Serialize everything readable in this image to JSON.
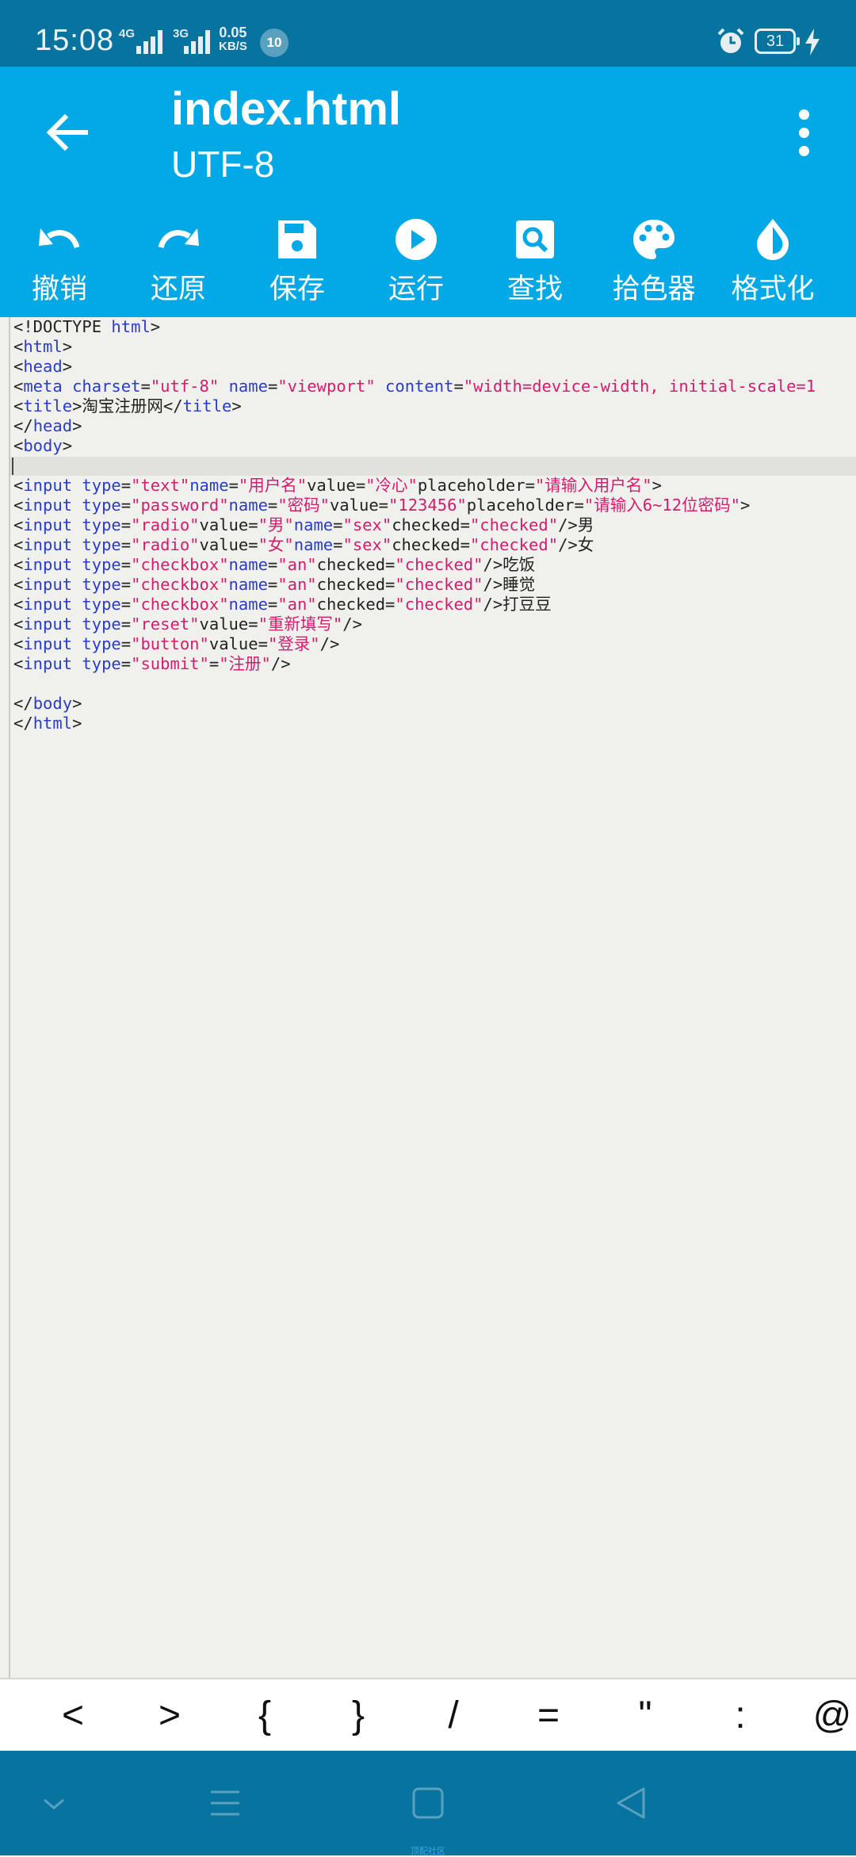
{
  "status_bar": {
    "time": "15:08",
    "network": "4G",
    "network2": "3G",
    "speed_value": "0.05",
    "speed_unit": "KB/S",
    "notification_count": "10",
    "battery": "31"
  },
  "header": {
    "title": "index.html",
    "subtitle": "UTF-8"
  },
  "toolbar": {
    "items": [
      {
        "label": "撤销",
        "icon": "undo-icon"
      },
      {
        "label": "还原",
        "icon": "redo-icon"
      },
      {
        "label": "保存",
        "icon": "save-icon"
      },
      {
        "label": "运行",
        "icon": "play-icon"
      },
      {
        "label": "查找",
        "icon": "search-icon"
      },
      {
        "label": "拾色器",
        "icon": "palette-icon"
      },
      {
        "label": "格式化",
        "icon": "format-drop-icon"
      }
    ]
  },
  "editor": {
    "lines": [
      "<!DOCTYPE html>",
      "<html>",
      "<head>",
      "<meta charset=\"utf-8\" name=\"viewport\" content=\"width=device-width, initial-scale=1",
      "<title>淘宝注册网</title>",
      "</head>",
      "<body>",
      "",
      "<input type=\"text\"name=\"用户名\"value=\"冷心\"placeholder=\"请输入用户名\">",
      "<input type=\"password\"name=\"密码\"value=\"123456\"placeholder=\"请输入6~12位密码\">",
      "<input type=\"radio\"value=\"男\"name=\"sex\"checked=\"checked\"/>男",
      "<input type=\"radio\"value=\"女\"name=\"sex\"checked=\"checked\"/>女",
      "<input type=\"checkbox\"name=\"an\"checked=\"checked\"/>吃饭",
      "<input type=\"checkbox\"name=\"an\"checked=\"checked\"/>睡觉",
      "<input type=\"checkbox\"name=\"an\"checked=\"checked\"/>打豆豆",
      "<input type=\"reset\"value=\"重新填写\"/>",
      "<input type=\"button\"value=\"登录\"/>",
      "<input type=\"submit\"=\"注册\"/>",
      "",
      "</body>",
      "</html>"
    ]
  },
  "symbol_bar": {
    "keys": [
      "<",
      ">",
      "{",
      "}",
      "/",
      "=",
      "\"",
      ":",
      "@"
    ]
  },
  "nav_bar": {
    "caption": "顶配社区"
  }
}
